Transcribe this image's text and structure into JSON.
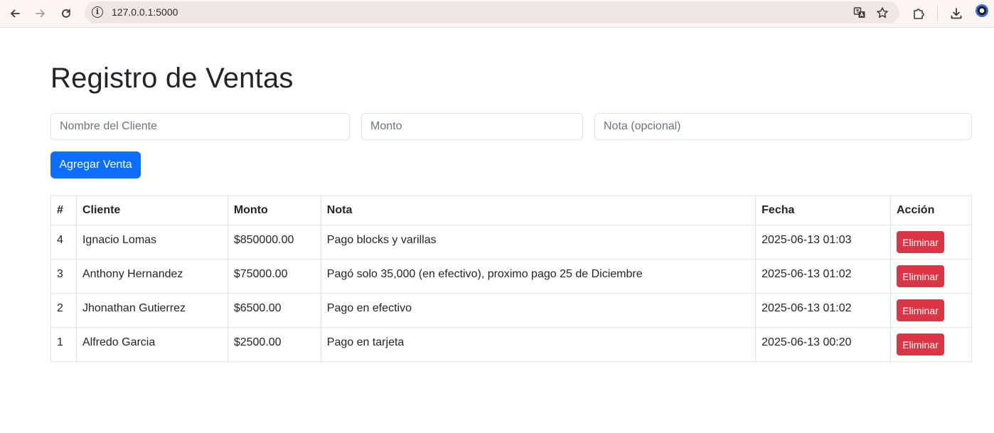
{
  "browser": {
    "url": "127.0.0.1:5000"
  },
  "page": {
    "title": "Registro de Ventas"
  },
  "form": {
    "cliente_placeholder": "Nombre del Cliente",
    "monto_placeholder": "Monto",
    "nota_placeholder": "Nota (opcional)",
    "submit_label": "Agregar Venta"
  },
  "table": {
    "headers": [
      "#",
      "Cliente",
      "Monto",
      "Nota",
      "Fecha",
      "Acción"
    ],
    "rows": [
      {
        "id": "4",
        "cliente": "Ignacio Lomas",
        "monto": "$850000.00",
        "nota": "Pago blocks y varillas",
        "fecha": "2025-06-13 01:03",
        "accion": "Eliminar"
      },
      {
        "id": "3",
        "cliente": "Anthony Hernandez",
        "monto": "$75000.00",
        "nota": "Pagó solo 35,000 (en efectivo), proximo pago 25 de Diciembre",
        "fecha": "2025-06-13 01:02",
        "accion": "Eliminar"
      },
      {
        "id": "2",
        "cliente": "Jhonathan Gutierrez",
        "monto": "$6500.00",
        "nota": "Pago en efectivo",
        "fecha": "2025-06-13 01:02",
        "accion": "Eliminar"
      },
      {
        "id": "1",
        "cliente": "Alfredo Garcia",
        "monto": "$2500.00",
        "nota": "Pago en tarjeta",
        "fecha": "2025-06-13 00:20",
        "accion": "Eliminar"
      }
    ]
  },
  "colors": {
    "primary": "#0d6efd",
    "danger": "#dc3545",
    "border": "#dee2e6"
  }
}
